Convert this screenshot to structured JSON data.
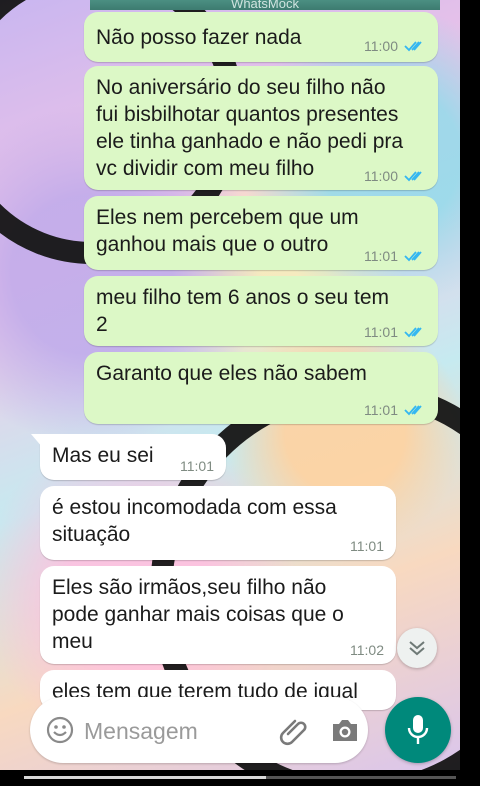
{
  "app": {
    "header_title": "WhatsMock"
  },
  "messages": [
    {
      "dir": "out",
      "text": "Não posso fazer nada",
      "time": "11:00",
      "read": true
    },
    {
      "dir": "out",
      "text": "No aniversário do seu filho não\nfui bisbilhotar quantos presentes\nele tinha ganhado e não pedi pra\nvc dividir com meu filho",
      "time": "11:00",
      "read": true
    },
    {
      "dir": "out",
      "text": "Eles nem percebem que um\nganhou mais que o outro",
      "time": "11:01",
      "read": true
    },
    {
      "dir": "out",
      "text": "meu filho tem 6 anos o seu tem\n2",
      "time": "11:01",
      "read": true
    },
    {
      "dir": "out",
      "text": "Garanto que eles não sabem",
      "time": "11:01",
      "read": true
    },
    {
      "dir": "in",
      "text": "Mas eu sei",
      "time": "11:01"
    },
    {
      "dir": "in",
      "text": "é estou incomodada com essa\nsituação",
      "time": "11:01"
    },
    {
      "dir": "in",
      "text": "Eles são irmãos,seu filho não\npode ganhar mais coisas que o\nmeu",
      "time": "11:02"
    },
    {
      "dir": "in",
      "text": "eles tem que terem tudo de igual",
      "time": ""
    }
  ],
  "composer": {
    "placeholder": "Mensagem"
  },
  "video_progress": {
    "fraction": 0.56
  },
  "colors": {
    "outgoing_bubble": "#dcf8c6",
    "incoming_bubble": "#ffffff",
    "read_ticks": "#34b7f1",
    "accent": "#00897b"
  }
}
